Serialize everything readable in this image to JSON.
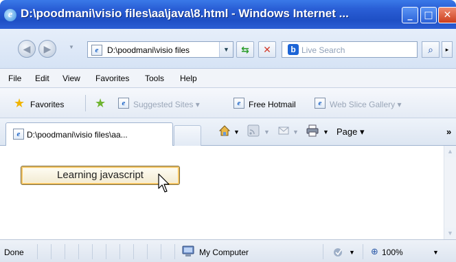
{
  "window": {
    "title": "D:\\poodmani\\visio files\\aa\\java\\8.html - Windows Internet ...",
    "min_glyph": "_",
    "max_glyph": "□",
    "close_glyph": "✕"
  },
  "navbar": {
    "address": "D:\\poodmani\\visio files",
    "search_placeholder": "Live Search",
    "bing_glyph": "b"
  },
  "menu": {
    "items": [
      "File",
      "Edit",
      "View",
      "Favorites",
      "Tools",
      "Help"
    ]
  },
  "favorites_bar": {
    "favorites_label": "Favorites",
    "suggested_sites": "Suggested Sites ▾",
    "free_hotmail": "Free Hotmail",
    "web_slice_gallery": "Web Slice Gallery ▾"
  },
  "tabs": {
    "active_tab_label": "D:\\poodmani\\visio files\\aa...",
    "page_menu": "Page ▾",
    "overflow": "»"
  },
  "content": {
    "button_label": "Learning javascript"
  },
  "statusbar": {
    "status": "Done",
    "zone": "My Computer",
    "zoom": "100%"
  },
  "colors": {
    "titlebar": "#2a5fd6",
    "button_border_highlight": "#f3c567"
  }
}
